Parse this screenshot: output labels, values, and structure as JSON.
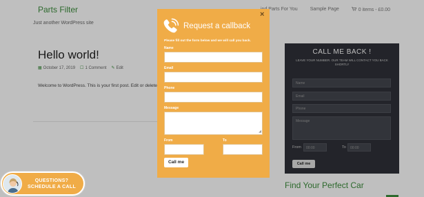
{
  "site": {
    "title": "Parts Filter",
    "tagline": "Just another WordPress site",
    "nav": {
      "item1": "ind Parts For You",
      "item2": "Sample Page",
      "cart": "0 items - £0.00"
    }
  },
  "post": {
    "title": "Hello world!",
    "date": "October 17, 2019",
    "comments": "1 Comment",
    "edit": "Edit",
    "body": "Welcome to WordPress. This is your first post. Edit or delete"
  },
  "widget": {
    "title": "CALL ME BACK !",
    "subtitle": "LEAVE YOUR NUMBER. OUR TEAM WILL CONTACT YOU BACK SHORTLY",
    "name_placeholder": "Name",
    "email_placeholder": "Email",
    "phone_placeholder": "Phone",
    "message_placeholder": "Message",
    "from_label": "From",
    "from_value": "00:00",
    "to_label": "To",
    "to_value": "00:00",
    "button": "Call me"
  },
  "find_car": "Find Your Perfect Car",
  "modal": {
    "title": "Request a callback",
    "intro": "Please fill out the form below and we will call you back.",
    "labels": {
      "name": "Name",
      "email": "Email",
      "phone": "Phone",
      "message": "Message",
      "from": "From",
      "to": "To"
    },
    "button": "Call me",
    "close": "×"
  },
  "pill": {
    "line1": "QUESTIONS?",
    "line2": "SCHEDULE A CALL"
  },
  "colors": {
    "modal_bg": "#f0ac47",
    "widget_bg": "#2f3138",
    "brand_green": "#3c8d3c"
  }
}
